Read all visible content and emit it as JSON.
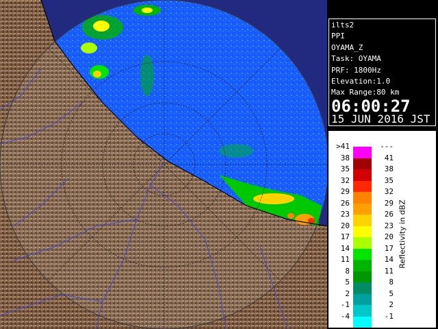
{
  "info": {
    "site": "ilts2",
    "product": "PPI",
    "field": "OYAMA_Z",
    "task": "Task: OYAMA",
    "prf": "PRF: 1800Hz",
    "elevation": "Elevation:1.0",
    "max_range": "Max Range:80 km",
    "time": "06:00:27",
    "date": "15 JUN 2016 JST"
  },
  "legend": {
    "unit_label": "Reflectivity in dBZ",
    "bins": [
      {
        "low": ">41",
        "high": "---",
        "color": "#ff00ff"
      },
      {
        "low": "38",
        "high": "41",
        "color": "#a00000"
      },
      {
        "low": "35",
        "high": "38",
        "color": "#d20000"
      },
      {
        "low": "32",
        "high": "35",
        "color": "#ff2800"
      },
      {
        "low": "29",
        "high": "32",
        "color": "#ff8200"
      },
      {
        "low": "26",
        "high": "29",
        "color": "#ffa000"
      },
      {
        "low": "23",
        "high": "26",
        "color": "#ffd200"
      },
      {
        "low": "20",
        "high": "23",
        "color": "#ffff00"
      },
      {
        "low": "17",
        "high": "20",
        "color": "#aaff00"
      },
      {
        "low": "14",
        "high": "17",
        "color": "#00e600"
      },
      {
        "low": "11",
        "high": "14",
        "color": "#00b400"
      },
      {
        "low": "8",
        "high": "11",
        "color": "#009600"
      },
      {
        "low": "5",
        "high": "8",
        "color": "#008c64"
      },
      {
        "low": "2",
        "high": "5",
        "color": "#00a0a0"
      },
      {
        "low": "-1",
        "high": "2",
        "color": "#00c8c8"
      },
      {
        "low": "-4",
        "high": "-1",
        "color": "#00ffff"
      }
    ]
  },
  "colors": {
    "echo_field": "#1e64ff",
    "terrain": "#7a5a40",
    "sea": "#2a2a7a"
  }
}
